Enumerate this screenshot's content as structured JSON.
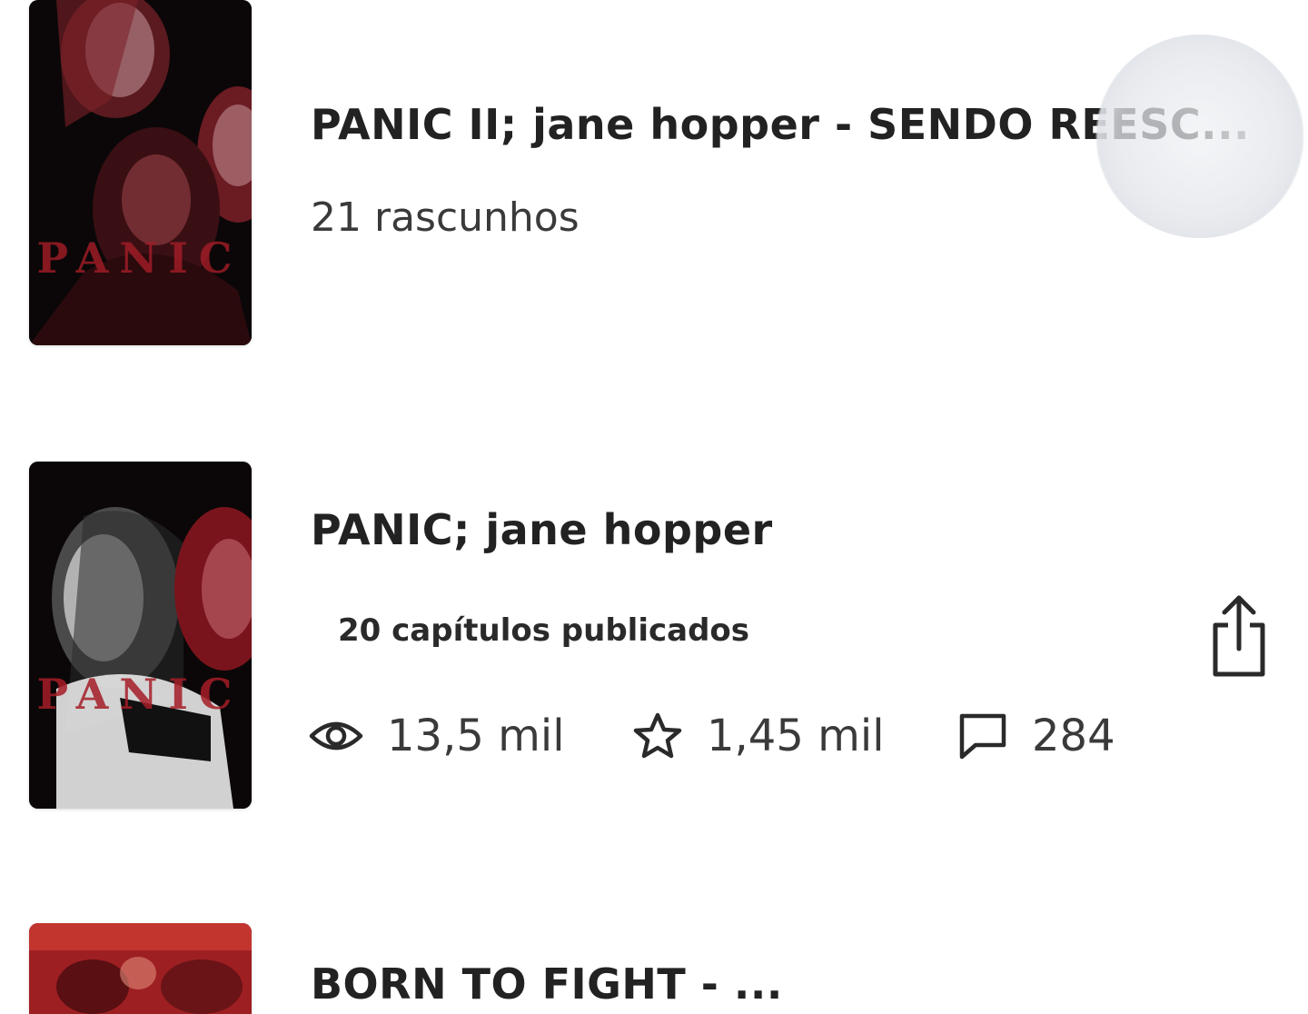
{
  "stories": [
    {
      "title": "PANIC II; jane hopper - SENDO REESC...",
      "drafts": "21 rascunhos",
      "cover_word": "PANIC"
    },
    {
      "title": "PANIC; jane hopper",
      "published": "20 capítulos publicados",
      "reads": "13,5 mil",
      "votes": "1,45 mil",
      "comments": "284",
      "cover_word": "PANIC"
    },
    {
      "title": "BORN TO FIGHT - ...",
      "cover_word": ""
    }
  ],
  "icons": {
    "reads": "eye-icon",
    "votes": "star-icon",
    "comments": "comment-icon",
    "share": "share-icon"
  },
  "colors": {
    "text": "#222222",
    "muted": "#3a3a3a",
    "cover_red": "#8c1a22",
    "cover_dark": "#0b0708"
  }
}
